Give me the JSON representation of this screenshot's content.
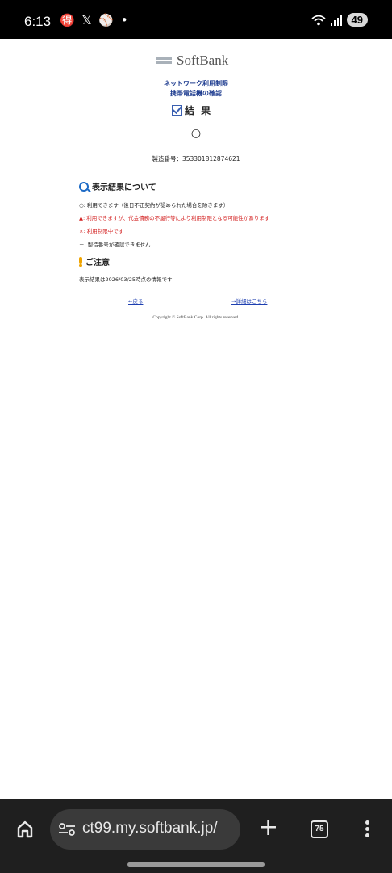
{
  "status_bar": {
    "time": "6:13",
    "left_icons": [
      "translate-icon",
      "x-logo-icon",
      "baseball-icon",
      "notification-dot-icon"
    ],
    "left_icons_text": "🉐 𝕏 ⚾ •",
    "battery": "49"
  },
  "page": {
    "logo": "SoftBank",
    "subtitle_line1": "ネットワーク利用制限",
    "subtitle_line2": "携帯電話機の確認",
    "result_heading": "結 果",
    "result_symbol": "○",
    "serial": "製造番号：353301812874621",
    "about_results": {
      "title": "表示結果について",
      "lines": [
        "○: 利用できます（後日不正契約が認められた場合を除きます）",
        "▲: 利用できますが、代金債務の不履行等により利用制限となる可能性があります",
        "×: 利用制限中です",
        "－: 製造番号が確認できません"
      ]
    },
    "notice": {
      "title": "ご注意",
      "text": "表示結果は2026/03/25時点の情報です"
    },
    "links": {
      "back": "←戻る",
      "details": "→詳細はこちら"
    },
    "copyright": "Copyright © SoftBank Corp. All rights reserved."
  },
  "browser": {
    "url": "ct99.my.softbank.jp/",
    "tab_count": "75"
  }
}
